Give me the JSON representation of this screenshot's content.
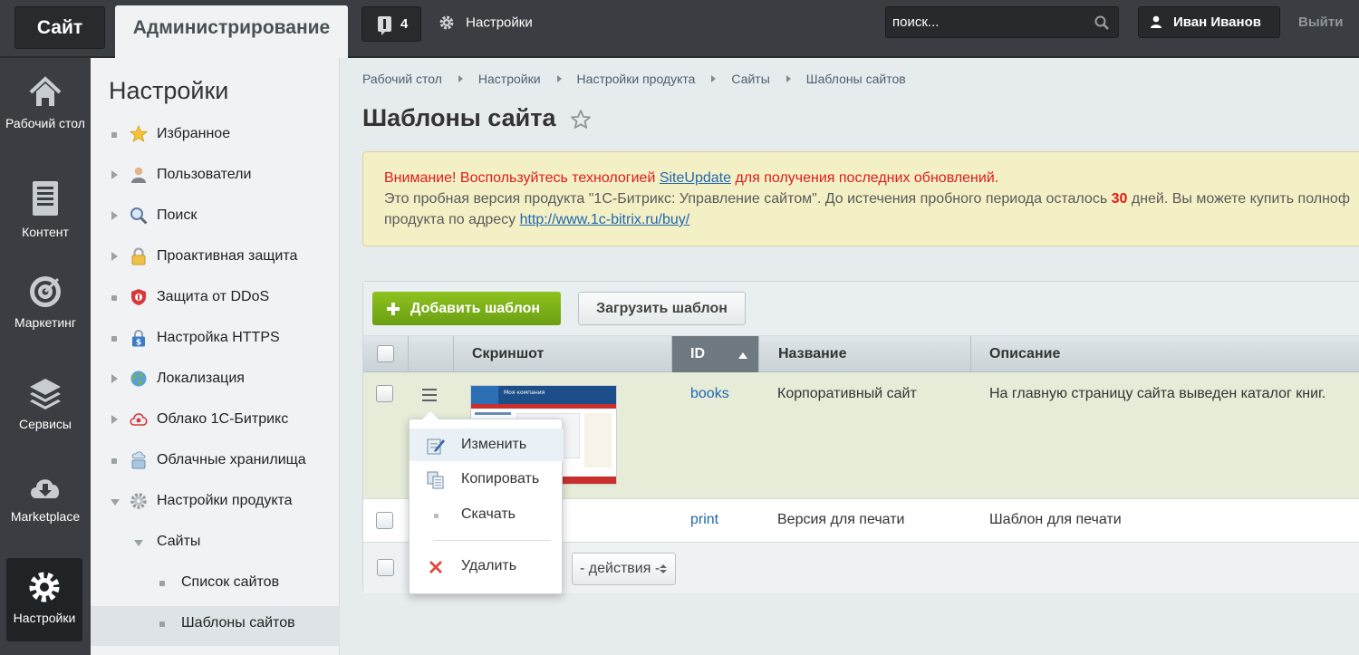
{
  "topbar": {
    "site_tab": "Сайт",
    "admin_tab": "Администрирование",
    "notifications_count": "4",
    "settings_label": "Настройки",
    "search_placeholder": "поиск...",
    "user_name": "Иван Иванов",
    "logout_label": "Выйти"
  },
  "left_menu": [
    {
      "label": "Рабочий стол",
      "icon": "house-icon"
    },
    {
      "label": "Контент",
      "icon": "document-icon"
    },
    {
      "label": "Маркетинг",
      "icon": "target-icon"
    },
    {
      "label": "Сервисы",
      "icon": "layers-icon"
    },
    {
      "label": "Marketplace",
      "icon": "cloud-download-icon"
    },
    {
      "label": "Настройки",
      "icon": "gear-icon",
      "active": true
    }
  ],
  "settings_panel": {
    "title": "Настройки",
    "items": [
      {
        "label": "Избранное",
        "icon": "star-icon"
      },
      {
        "label": "Пользователи",
        "icon": "user-icon"
      },
      {
        "label": "Поиск",
        "icon": "magnifier-icon"
      },
      {
        "label": "Проактивная защита",
        "icon": "lock-icon"
      },
      {
        "label": "Защита от DDoS",
        "icon": "shield-icon"
      },
      {
        "label": "Настройка HTTPS",
        "icon": "https-icon"
      },
      {
        "label": "Локализация",
        "icon": "globe-icon"
      },
      {
        "label": "Облако 1С-Битрикс",
        "icon": "cloud-icon"
      },
      {
        "label": "Облачные хранилища",
        "icon": "storage-icon"
      },
      {
        "label": "Настройки продукта",
        "icon": "gear-icon"
      },
      {
        "label": "Сайты"
      },
      {
        "label": "Список сайтов"
      },
      {
        "label": "Шаблоны сайтов",
        "active": true
      }
    ]
  },
  "breadcrumbs": [
    "Рабочий стол",
    "Настройки",
    "Настройки продукта",
    "Сайты",
    "Шаблоны сайтов"
  ],
  "page_title": "Шаблоны сайта",
  "notice": {
    "line1_prefix": "Внимание! Воспользуйтесь технологией ",
    "line1_link": "SiteUpdate",
    "line1_suffix": " для получения последних обновлений.",
    "line2_prefix": "Это пробная версия продукта \"1С-Битрикс: Управление сайтом\". До истечения пробного периода осталось ",
    "line2_days": "30",
    "line2_suffix": " дней. Вы можете купить полноф",
    "line3_prefix": "продукта по адресу ",
    "line3_link": "http://www.1c-bitrix.ru/buy/"
  },
  "toolbar": {
    "add_label": "Добавить шаблон",
    "upload_label": "Загрузить шаблон"
  },
  "table": {
    "headers": {
      "screenshot": "Скриншот",
      "id": "ID",
      "name": "Название",
      "description": "Описание"
    },
    "rows": [
      {
        "id": "books",
        "name": "Корпоративный сайт",
        "description": "На главную страницу сайта выведен каталог книг."
      },
      {
        "id": "print",
        "name": "Версия для печати",
        "description": "Шаблон для печати"
      }
    ],
    "actions_select": "- действия -"
  },
  "thumbnail": {
    "header_text": "Моя компания"
  },
  "context_menu": {
    "items": [
      {
        "label": "Изменить",
        "icon": "edit-icon"
      },
      {
        "label": "Копировать",
        "icon": "copy-icon"
      },
      {
        "label": "Скачать",
        "icon": "dot-icon"
      },
      {
        "label": "Удалить",
        "icon": "delete-icon"
      }
    ]
  },
  "colors": {
    "accent_green": "#7cb118",
    "warning_red": "#e01b1b",
    "link_blue": "#2067b0",
    "dark_bar": "#3a3e42"
  }
}
